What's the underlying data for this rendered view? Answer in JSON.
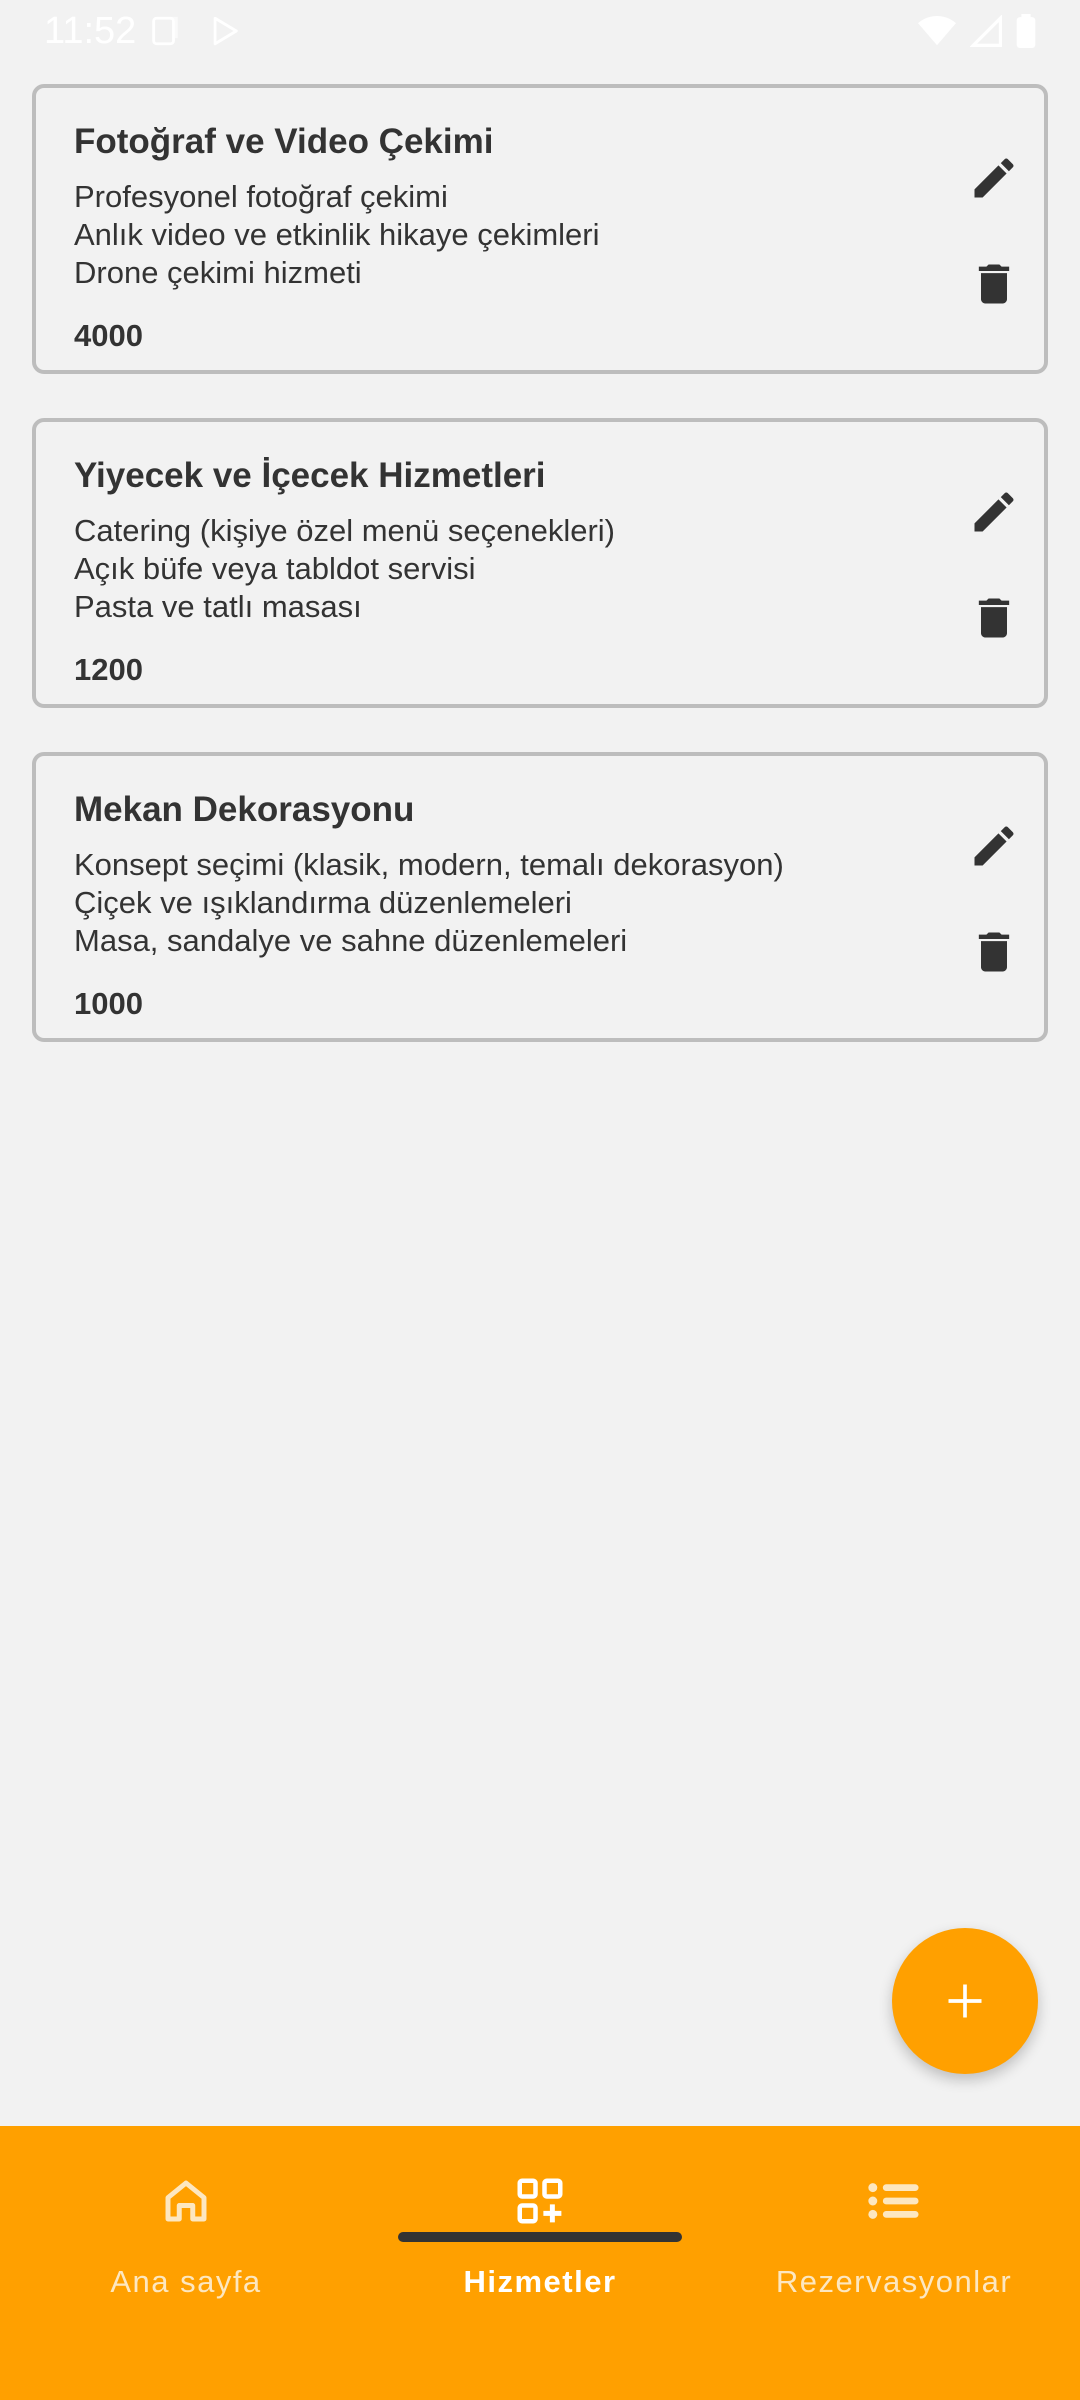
{
  "status_bar": {
    "time": "11:52"
  },
  "services": [
    {
      "title": "Fotoğraf ve Video Çekimi",
      "lines": [
        "Profesyonel fotoğraf çekimi",
        "Anlık video ve etkinlik hikaye çekimleri",
        "Drone çekimi hizmeti"
      ],
      "price": "4000"
    },
    {
      "title": "Yiyecek ve İçecek Hizmetleri",
      "lines": [
        "Catering (kişiye özel menü seçenekleri)",
        "Açık büfe veya tabldot servisi",
        "Pasta ve tatlı masası"
      ],
      "price": "1200"
    },
    {
      "title": "Mekan Dekorasyonu",
      "lines": [
        "Konsept seçimi (klasik, modern, temalı dekorasyon)",
        "Çiçek ve ışıklandırma düzenlemeleri",
        "Masa, sandalye ve sahne düzenlemeleri"
      ],
      "price": "1000"
    }
  ],
  "icons": {
    "edit": "pencil-icon",
    "delete": "trash-icon",
    "fab": "plus-icon"
  },
  "bottom_nav": {
    "items": [
      {
        "label": "Ana sayfa",
        "icon": "home-icon",
        "active": false
      },
      {
        "label": "Hizmetler",
        "icon": "grid-add-icon",
        "active": true
      },
      {
        "label": "Rezervasyonlar",
        "icon": "list-icon",
        "active": false
      }
    ]
  },
  "colors": {
    "accent": "#ffa000",
    "background": "#f2f2f2",
    "card_border": "#bdbdbd",
    "text": "#333333"
  }
}
